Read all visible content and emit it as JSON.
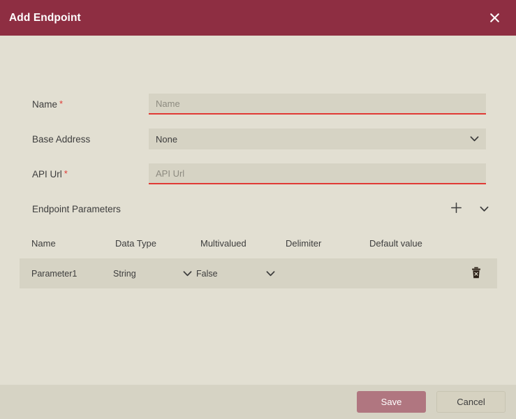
{
  "header": {
    "title": "Add Endpoint",
    "close_icon": "close-icon"
  },
  "form": {
    "fields": [
      {
        "label": "Name",
        "required": true,
        "required_marker": "*",
        "control": "text",
        "value": "",
        "placeholder": "Name",
        "invalid": true
      },
      {
        "label": "Base Address",
        "required": false,
        "required_marker": "",
        "control": "select",
        "value": "None",
        "placeholder": "",
        "invalid": false,
        "chevron_icon": "chevron-down-icon"
      },
      {
        "label": "API Url",
        "required": true,
        "required_marker": "*",
        "control": "text",
        "value": "",
        "placeholder": "API Url",
        "invalid": true
      }
    ]
  },
  "parameters_section": {
    "label": "Endpoint Parameters",
    "add_icon": "plus-icon",
    "collapse_icon": "chevron-down-icon",
    "columns": [
      "Name",
      "Data Type",
      "Multivalued",
      "Delimiter",
      "Default value"
    ],
    "rows": [
      {
        "name": "Parameter1",
        "data_type": "String",
        "data_type_chevron": "chevron-down-icon",
        "multivalued": "False",
        "multivalued_chevron": "chevron-down-icon",
        "delimiter": "",
        "default_value": "",
        "delete_icon": "trash-icon"
      }
    ]
  },
  "footer": {
    "save_label": "Save",
    "cancel_label": "Cancel"
  },
  "colors": {
    "header_bg": "#8e2e42",
    "page_bg": "#e2dfd2",
    "field_bg": "#d6d3c4",
    "footer_bg": "#d6d3c4",
    "required_red": "#e03a35",
    "save_bg": "#b07680",
    "cancel_bg": "#d6d2c1",
    "text": "#3d3d3d"
  }
}
